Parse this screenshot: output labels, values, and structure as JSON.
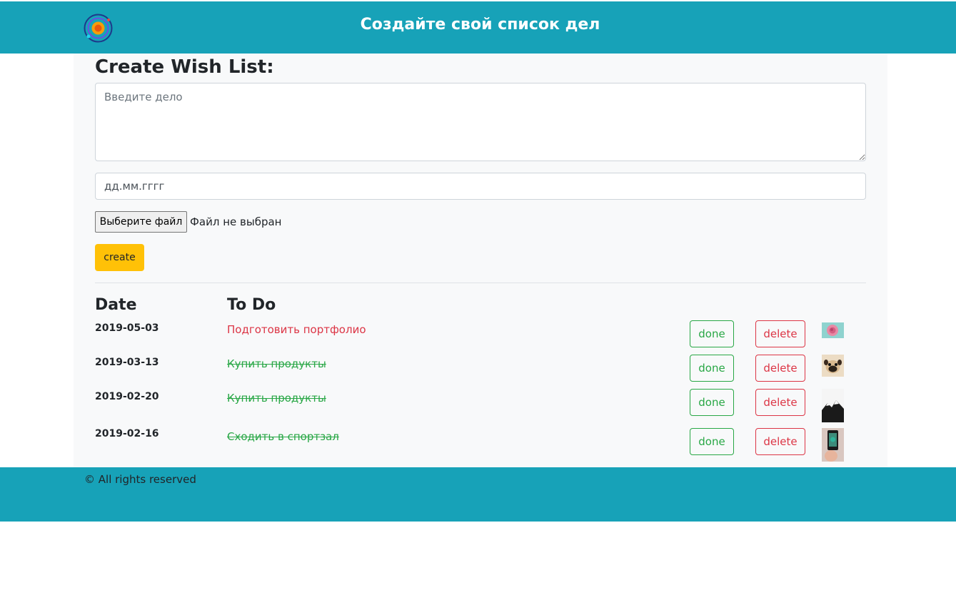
{
  "header": {
    "logo_icon": "planet-orbit-logo",
    "title": "Создайте свой список дел",
    "bg_color": "#17a2b8"
  },
  "form": {
    "heading": "Create Wish List:",
    "task_placeholder": "Введите дело",
    "date_value": "дд.мм.гггг",
    "file_button_label": "Выберите файл",
    "file_status": "Файл не выбран",
    "create_label": "create"
  },
  "list": {
    "col_date": "Date",
    "col_todo": "To Do",
    "rows": [
      {
        "date": "2019-05-03",
        "task": "Подготовить портфолио",
        "completed": false,
        "done_label": "done",
        "delete_label": "delete",
        "thumb_icon": "rose-photo"
      },
      {
        "date": "2019-03-13",
        "task": "Купить продукты",
        "completed": true,
        "done_label": "done",
        "delete_label": "delete",
        "thumb_icon": "pug-photo"
      },
      {
        "date": "2019-02-20",
        "task": "Купить продукты",
        "completed": true,
        "done_label": "done",
        "delete_label": "delete",
        "thumb_icon": "mountain-photo"
      },
      {
        "date": "2019-02-16",
        "task": "Сходить в спортзал",
        "completed": true,
        "done_label": "done",
        "delete_label": "delete",
        "thumb_icon": "phone-photo"
      }
    ]
  },
  "footer": {
    "copyright": "© All rights reserved"
  },
  "colors": {
    "accent": "#17a2b8",
    "warning": "#ffc107",
    "success": "#28a745",
    "danger": "#dc3545"
  }
}
